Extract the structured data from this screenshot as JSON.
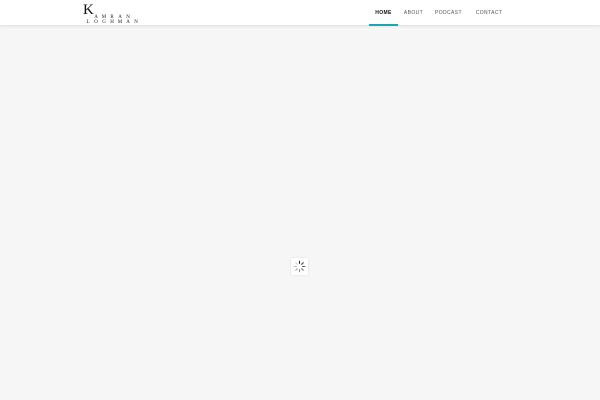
{
  "logo": {
    "initial": "K",
    "line1": [
      "A",
      "M",
      "R",
      "A",
      "N"
    ],
    "line2": [
      "L",
      "O",
      "G",
      "H",
      "M",
      "A",
      "N"
    ]
  },
  "nav": {
    "items": [
      {
        "label": "HOME",
        "active": true
      },
      {
        "label": "ABOUT",
        "active": false
      },
      {
        "label": "PODCAST",
        "active": false
      },
      {
        "label": "CONTACT",
        "active": false
      }
    ],
    "accent_color": "#17a9ab"
  },
  "loader": {
    "icon": "spinner-icon"
  },
  "colors": {
    "background": "#f6f6f6",
    "header_background": "#ffffff"
  }
}
